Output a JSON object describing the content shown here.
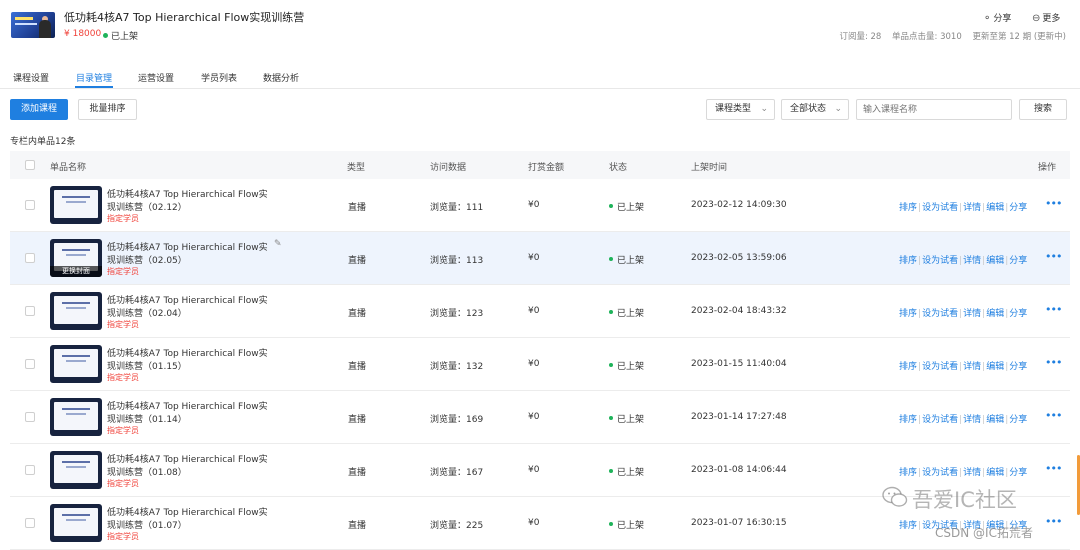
{
  "header": {
    "title": "低功耗4核A7 Top Hierarchical Flow实现训练营",
    "price": "¥ 18000",
    "status": "已上架",
    "share_label": "分享",
    "more_label": "更多",
    "stats": {
      "subscriptions": "订阅量: 28",
      "clicks": "单品点击量: 3010",
      "updated": "更新至第 12 期 (更新中)"
    }
  },
  "tabs": [
    {
      "label": "课程设置"
    },
    {
      "label": "目录管理"
    },
    {
      "label": "运营设置"
    },
    {
      "label": "学员列表"
    },
    {
      "label": "数据分析"
    }
  ],
  "toolbar": {
    "add_label": "添加课程",
    "batch_sort_label": "批量排序",
    "type_select": "课程类型",
    "status_select": "全部状态",
    "search_placeholder": "输入课程名称",
    "search_label": "搜索"
  },
  "count_label": "专栏内单品12条",
  "table": {
    "headers": {
      "name": "单品名称",
      "type": "类型",
      "visits": "访问数据",
      "tips": "打赏金额",
      "status": "状态",
      "time": "上架时间",
      "ops": "操作"
    },
    "cover_change_label": "更换封面",
    "rows": [
      {
        "title": "低功耗4核A7 Top Hierarchical Flow实",
        "subtitle": "现训练营（02.12）",
        "tag": "指定学员",
        "type": "直播",
        "visits": "浏览量：111",
        "tips": "¥0",
        "status": "已上架",
        "time": "2023-02-12 14:09:30"
      },
      {
        "title": "低功耗4核A7 Top Hierarchical Flow实",
        "subtitle": "现训练营（02.05）",
        "tag": "指定学员",
        "type": "直播",
        "visits": "浏览量：113",
        "tips": "¥0",
        "status": "已上架",
        "time": "2023-02-05 13:59:06"
      },
      {
        "title": "低功耗4核A7 Top Hierarchical Flow实",
        "subtitle": "现训练营（02.04）",
        "tag": "指定学员",
        "type": "直播",
        "visits": "浏览量：123",
        "tips": "¥0",
        "status": "已上架",
        "time": "2023-02-04 18:43:32"
      },
      {
        "title": "低功耗4核A7 Top Hierarchical Flow实",
        "subtitle": "现训练营（01.15）",
        "tag": "指定学员",
        "type": "直播",
        "visits": "浏览量：132",
        "tips": "¥0",
        "status": "已上架",
        "time": "2023-01-15 11:40:04"
      },
      {
        "title": "低功耗4核A7 Top Hierarchical Flow实",
        "subtitle": "现训练营（01.14）",
        "tag": "指定学员",
        "type": "直播",
        "visits": "浏览量：169",
        "tips": "¥0",
        "status": "已上架",
        "time": "2023-01-14 17:27:48"
      },
      {
        "title": "低功耗4核A7 Top Hierarchical Flow实",
        "subtitle": "现训练营（01.08）",
        "tag": "指定学员",
        "type": "直播",
        "visits": "浏览量：167",
        "tips": "¥0",
        "status": "已上架",
        "time": "2023-01-08 14:06:44"
      },
      {
        "title": "低功耗4核A7 Top Hierarchical Flow实",
        "subtitle": "现训练营（01.07）",
        "tag": "指定学员",
        "type": "直播",
        "visits": "浏览量：225",
        "tips": "¥0",
        "status": "已上架",
        "time": "2023-01-07 16:30:15"
      }
    ],
    "ops": [
      "排序",
      "设为试看",
      "详情",
      "编辑",
      "分享"
    ]
  },
  "watermark": {
    "line1": "吾爱IC社区",
    "line2": "CSDN @IC拓荒者"
  },
  "colors": {
    "accent": "#1f7fe0",
    "price": "#f0423a",
    "status_green": "#1fb35a",
    "row_highlight": "#eef4fd"
  }
}
